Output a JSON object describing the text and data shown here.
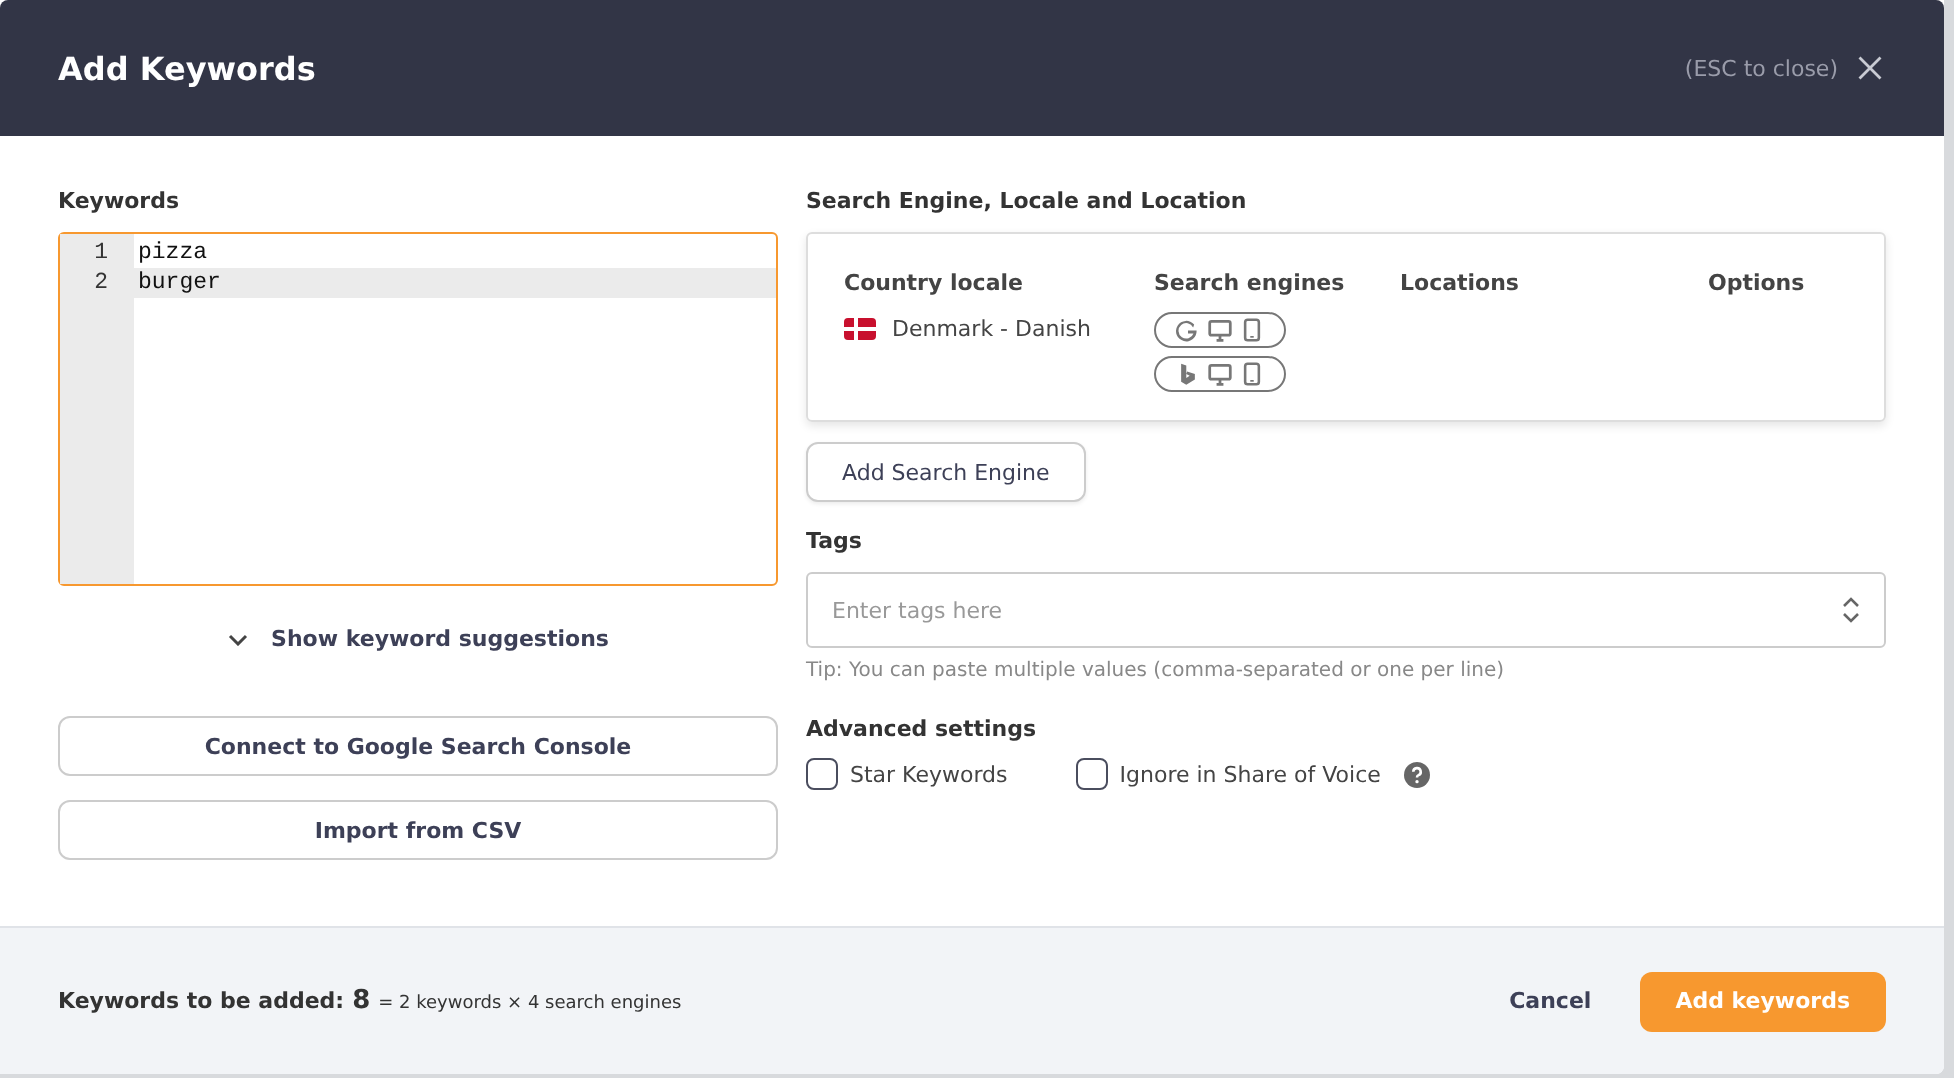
{
  "dialog": {
    "title": "Add Keywords",
    "close_hint": "(ESC to close)"
  },
  "keywords": {
    "label": "Keywords",
    "lines": [
      {
        "number": "1",
        "text": "pizza",
        "selected": false
      },
      {
        "number": "2",
        "text": "burger",
        "selected": true
      }
    ]
  },
  "suggestions_toggle": "Show keyword suggestions",
  "left_buttons": [
    "Connect to Google Search Console",
    "Import from CSV"
  ],
  "search_engines": {
    "label": "Search Engine, Locale and Location",
    "columns": [
      "Country locale",
      "Search engines",
      "Locations",
      "Options"
    ],
    "rows": [
      {
        "locale": "Denmark - Danish",
        "engines": [
          {
            "kind": "google"
          },
          {
            "kind": "bing"
          }
        ]
      }
    ],
    "add_button": "Add Search Engine"
  },
  "tags": {
    "label": "Tags",
    "placeholder": "Enter tags here",
    "tip": "Tip: You can paste multiple values (comma-separated or one per line)"
  },
  "advanced": {
    "label": "Advanced settings",
    "options": [
      {
        "label": "Star Keywords",
        "checked": false,
        "help": false
      },
      {
        "label": "Ignore in Share of Voice",
        "checked": false,
        "help": true
      }
    ]
  },
  "footer": {
    "summary_label": "Keywords to be added:",
    "count": "8",
    "formula": "= 2 keywords × 4 search engines",
    "cancel": "Cancel",
    "submit": "Add keywords"
  }
}
